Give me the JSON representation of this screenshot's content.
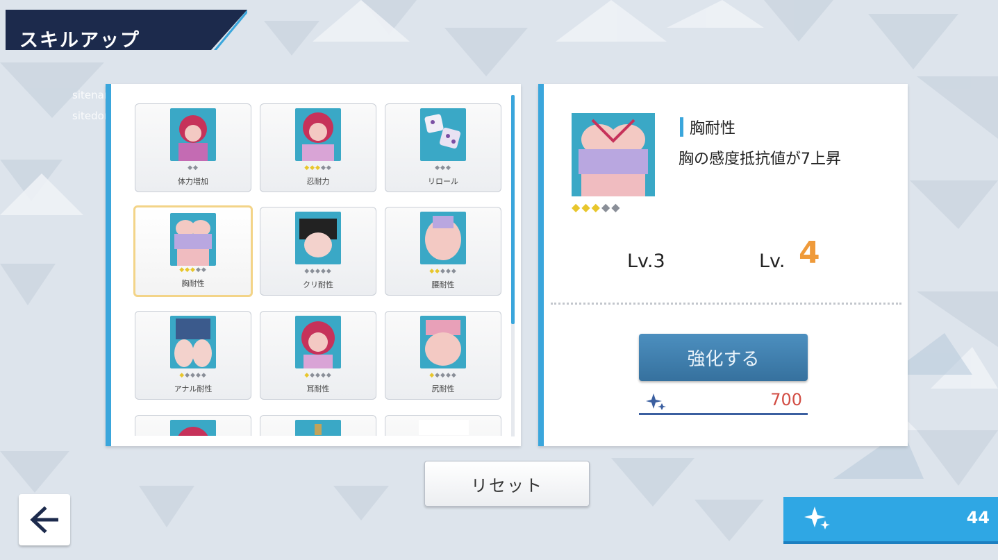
{
  "screen_title": "スキルアップ",
  "watermark": {
    "line1": "sitename: フ・ブ",
    "line2": "sitedomain: https://fxacg.co"
  },
  "colors": {
    "accent_blue": "#3aa6dc",
    "title_navy": "#1c2a4c",
    "level_orange": "#ef9a3a",
    "cost_red": "#d24d44",
    "gem_gold": "#e8c62c",
    "gem_gray": "#8a8f98"
  },
  "skills": [
    {
      "label": "体力増加",
      "gems_on": 0,
      "gems_total": 2,
      "selected": false
    },
    {
      "label": "忍耐力",
      "gems_on": 3,
      "gems_total": 5,
      "selected": false
    },
    {
      "label": "リロール",
      "gems_on": 0,
      "gems_total": 3,
      "selected": false
    },
    {
      "label": "胸耐性",
      "gems_on": 3,
      "gems_total": 5,
      "selected": true
    },
    {
      "label": "クリ耐性",
      "gems_on": 0,
      "gems_total": 5,
      "selected": false
    },
    {
      "label": "腰耐性",
      "gems_on": 2,
      "gems_total": 5,
      "selected": false
    },
    {
      "label": "アナル耐性",
      "gems_on": 1,
      "gems_total": 5,
      "selected": false
    },
    {
      "label": "耳耐性",
      "gems_on": 1,
      "gems_total": 5,
      "selected": false
    },
    {
      "label": "尻耐性",
      "gems_on": 1,
      "gems_total": 5,
      "selected": false
    }
  ],
  "detail": {
    "name": "胸耐性",
    "description": "胸の感度抵抗値が7上昇",
    "gems_on": 3,
    "gems_total": 5,
    "current_level": "Lv.3",
    "next_level_label": "Lv.",
    "next_level_number": "4",
    "enhance_label": "強化する",
    "cost": "700"
  },
  "reset_label": "リセット",
  "currency_amount": "44",
  "icons": {
    "back": "arrow-left-icon",
    "cost": "sparkle-icon",
    "currency": "sparkle-icon"
  }
}
